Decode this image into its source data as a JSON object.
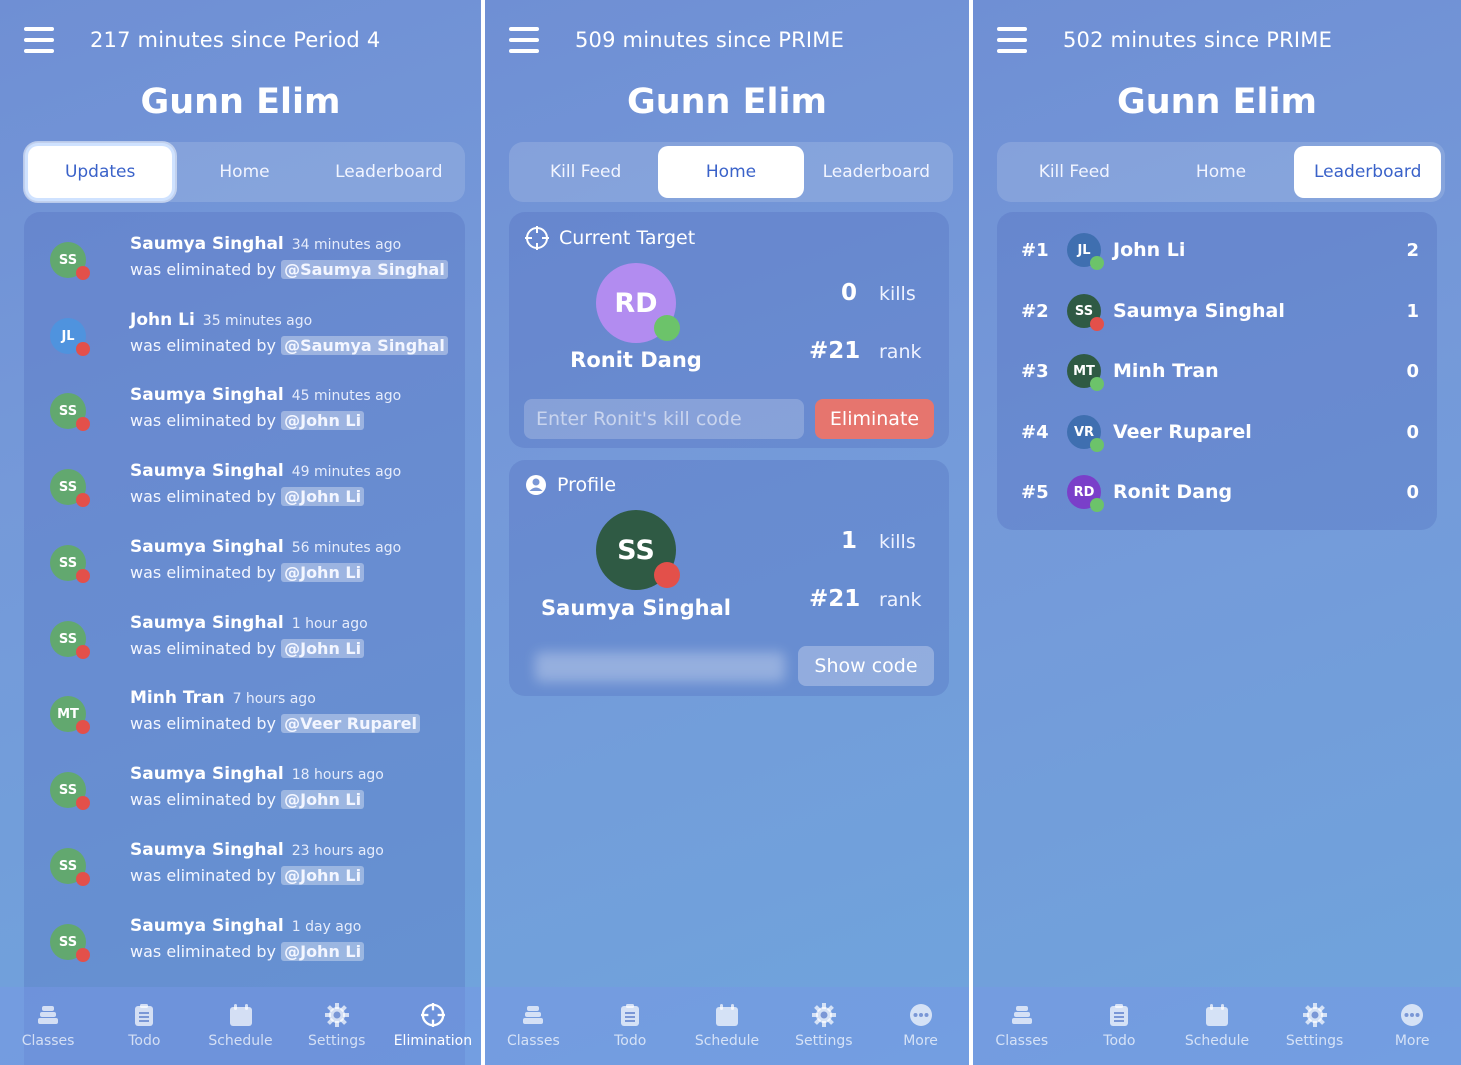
{
  "colors": {
    "green_dot": "#6cc36a",
    "red_dot": "#e3504a",
    "eliminate_button": "#e6756e",
    "active_tab_text": "#3a62c9"
  },
  "screen1": {
    "topbar_title": "217 minutes since Period 4",
    "page_title": "Gunn Elim",
    "tabs": [
      "Updates",
      "Home",
      "Leaderboard"
    ],
    "active_tab": "Updates",
    "feed": [
      {
        "initials": "SS",
        "name": "Saumya Singhal",
        "time": "34 minutes ago",
        "action": "was eliminated by",
        "by": "@Saumya Singhal",
        "avatar_color": "#62a86f"
      },
      {
        "initials": "JL",
        "name": "John Li",
        "time": "35 minutes ago",
        "action": "was eliminated by",
        "by": "@Saumya Singhal",
        "avatar_color": "#4f93de"
      },
      {
        "initials": "SS",
        "name": "Saumya Singhal",
        "time": "45 minutes ago",
        "action": "was eliminated by",
        "by": "@John Li",
        "avatar_color": "#62a86f"
      },
      {
        "initials": "SS",
        "name": "Saumya Singhal",
        "time": "49 minutes ago",
        "action": "was eliminated by",
        "by": "@John Li",
        "avatar_color": "#62a86f"
      },
      {
        "initials": "SS",
        "name": "Saumya Singhal",
        "time": "56 minutes ago",
        "action": "was eliminated by",
        "by": "@John Li",
        "avatar_color": "#62a86f"
      },
      {
        "initials": "SS",
        "name": "Saumya Singhal",
        "time": "1 hour ago",
        "action": "was eliminated by",
        "by": "@John Li",
        "avatar_color": "#62a86f"
      },
      {
        "initials": "MT",
        "name": "Minh Tran",
        "time": "7 hours ago",
        "action": "was eliminated by",
        "by": "@Veer Ruparel",
        "avatar_color": "#62a86f"
      },
      {
        "initials": "SS",
        "name": "Saumya Singhal",
        "time": "18 hours ago",
        "action": "was eliminated by",
        "by": "@John Li",
        "avatar_color": "#62a86f"
      },
      {
        "initials": "SS",
        "name": "Saumya Singhal",
        "time": "23 hours ago",
        "action": "was eliminated by",
        "by": "@John Li",
        "avatar_color": "#62a86f"
      },
      {
        "initials": "SS",
        "name": "Saumya Singhal",
        "time": "1 day ago",
        "action": "was eliminated by",
        "by": "@John Li",
        "avatar_color": "#62a86f"
      }
    ],
    "nav": [
      {
        "label": "Classes",
        "icon": "classes-icon"
      },
      {
        "label": "Todo",
        "icon": "todo-icon"
      },
      {
        "label": "Schedule",
        "icon": "schedule-icon"
      },
      {
        "label": "Settings",
        "icon": "settings-icon"
      },
      {
        "label": "Elimination",
        "icon": "crosshair-icon"
      }
    ],
    "active_nav": "Elimination"
  },
  "screen2": {
    "topbar_title": "509 minutes since PRIME",
    "page_title": "Gunn Elim",
    "tabs": [
      "Kill Feed",
      "Home",
      "Leaderboard"
    ],
    "active_tab": "Home",
    "target": {
      "heading": "Current Target",
      "initials": "RD",
      "name": "Ronit Dang",
      "avatar_color": "#b28cf0",
      "kills": "0",
      "kills_label": "kills",
      "rank": "#21",
      "rank_label": "rank",
      "input_placeholder": "Enter Ronit's kill code",
      "button": "Eliminate"
    },
    "profile": {
      "heading": "Profile",
      "initials": "SS",
      "name": "Saumya Singhal",
      "avatar_color": "#2f5a44",
      "kills": "1",
      "kills_label": "kills",
      "rank": "#21",
      "rank_label": "rank",
      "button": "Show code"
    },
    "nav": [
      {
        "label": "Classes",
        "icon": "classes-icon"
      },
      {
        "label": "Todo",
        "icon": "todo-icon"
      },
      {
        "label": "Schedule",
        "icon": "schedule-icon"
      },
      {
        "label": "Settings",
        "icon": "settings-icon"
      },
      {
        "label": "More",
        "icon": "more-icon"
      }
    ]
  },
  "screen3": {
    "topbar_title": "502 minutes since PRIME",
    "page_title": "Gunn Elim",
    "tabs": [
      "Kill Feed",
      "Home",
      "Leaderboard"
    ],
    "active_tab": "Leaderboard",
    "leaderboard": [
      {
        "rank": "#1",
        "initials": "JL",
        "name": "John Li",
        "kills": "2",
        "avatar_color": "#3f6fb0",
        "status": "alive"
      },
      {
        "rank": "#2",
        "initials": "SS",
        "name": "Saumya Singhal",
        "kills": "1",
        "avatar_color": "#2f5a44",
        "status": "eliminated"
      },
      {
        "rank": "#3",
        "initials": "MT",
        "name": "Minh Tran",
        "kills": "0",
        "avatar_color": "#2f5a44",
        "status": "alive"
      },
      {
        "rank": "#4",
        "initials": "VR",
        "name": "Veer Ruparel",
        "kills": "0",
        "avatar_color": "#3f6fb0",
        "status": "alive"
      },
      {
        "rank": "#5",
        "initials": "RD",
        "name": "Ronit Dang",
        "kills": "0",
        "avatar_color": "#7a3fc9",
        "status": "alive"
      }
    ],
    "nav": [
      {
        "label": "Classes",
        "icon": "classes-icon"
      },
      {
        "label": "Todo",
        "icon": "todo-icon"
      },
      {
        "label": "Schedule",
        "icon": "schedule-icon"
      },
      {
        "label": "Settings",
        "icon": "settings-icon"
      },
      {
        "label": "More",
        "icon": "more-icon"
      }
    ]
  }
}
